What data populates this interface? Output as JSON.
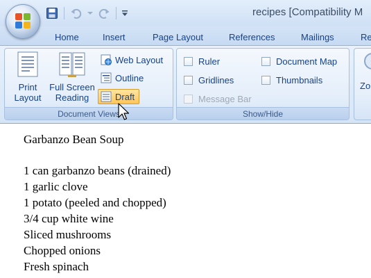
{
  "window": {
    "title": "recipes [Compatibility M"
  },
  "quick_access": {
    "icons": [
      "save-icon",
      "undo-icon",
      "redo-icon",
      "customize-icon"
    ]
  },
  "tabs": [
    {
      "label": "Home"
    },
    {
      "label": "Insert"
    },
    {
      "label": "Page Layout"
    },
    {
      "label": "References"
    },
    {
      "label": "Mailings"
    },
    {
      "label": "Re"
    }
  ],
  "ribbon": {
    "document_views": {
      "label": "Document Views",
      "print_layout": "Print Layout",
      "print_layout_l1": "Print",
      "print_layout_l2": "Layout",
      "full_screen_l1": "Full Screen",
      "full_screen_l2": "Reading",
      "web_layout": "Web Layout",
      "outline": "Outline",
      "draft": "Draft"
    },
    "show_hide": {
      "label": "Show/Hide",
      "ruler": "Ruler",
      "gridlines": "Gridlines",
      "message_bar": "Message Bar",
      "document_map": "Document Map",
      "thumbnails": "Thumbnails"
    },
    "zoom": {
      "label_partial": "Zo"
    }
  },
  "document": {
    "lines": [
      "Garbanzo Bean Soup",
      "1 can garbanzo beans (drained)",
      "1 garlic clove",
      "1 potato (peeled and chopped)",
      "3/4 cup white wine",
      "Sliced mushrooms",
      "Chopped onions",
      "Fresh spinach"
    ]
  }
}
